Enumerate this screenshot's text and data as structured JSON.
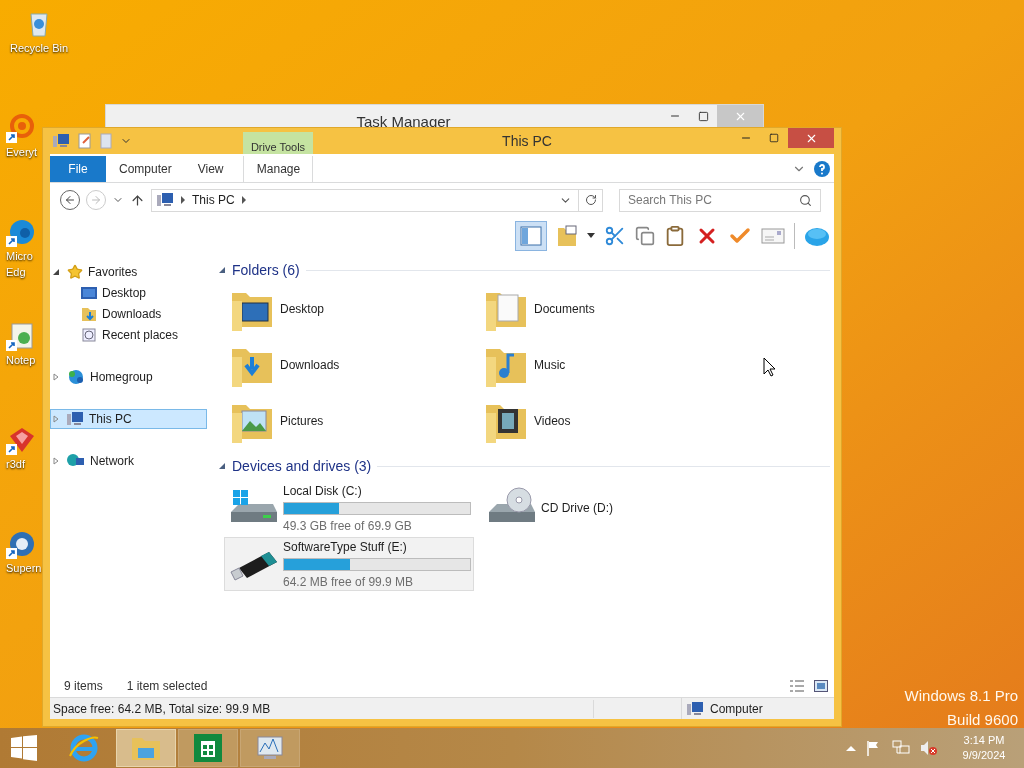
{
  "desktop": {
    "icons": [
      {
        "label": "Recycle Bin",
        "kind": "bin"
      },
      {
        "label": "Everyt",
        "kind": "ring"
      },
      {
        "label": "Micro Edg",
        "kind": "edge"
      },
      {
        "label": "Notep",
        "kind": "notepad"
      },
      {
        "label": "r3df",
        "kind": "r3d"
      },
      {
        "label": "Supern",
        "kind": "globe"
      }
    ],
    "edition": "Windows 8.1 Pro",
    "build": "Build 9600"
  },
  "background_window": {
    "title": "Task Manager"
  },
  "explorer": {
    "title": "This PC",
    "contextual_tab": "Drive Tools",
    "ribbon_tabs": [
      {
        "label": "File",
        "kind": "file"
      },
      {
        "label": "Computer",
        "kind": "tab"
      },
      {
        "label": "View",
        "kind": "tab"
      },
      {
        "label": "Manage",
        "kind": "contextual"
      }
    ],
    "address": {
      "path": [
        "This PC"
      ]
    },
    "search": {
      "placeholder": "Search This PC"
    },
    "nav": [
      {
        "label": "Favorites",
        "kind": "favorites",
        "expanded": true,
        "selected": false,
        "children": [
          {
            "label": "Desktop",
            "kind": "desktop",
            "selected": false
          },
          {
            "label": "Downloads",
            "kind": "downloads",
            "selected": false
          },
          {
            "label": "Recent places",
            "kind": "recent",
            "selected": false
          }
        ]
      },
      {
        "label": "Homegroup",
        "kind": "homegroup",
        "expanded": false,
        "selected": false
      },
      {
        "label": "This PC",
        "kind": "pc",
        "expanded": false,
        "selected": true
      },
      {
        "label": "Network",
        "kind": "network",
        "expanded": false,
        "selected": false
      }
    ],
    "folders": {
      "header": "Folders (6)",
      "items": [
        {
          "name": "Desktop",
          "kind": "desktop"
        },
        {
          "name": "Documents",
          "kind": "documents"
        },
        {
          "name": "Downloads",
          "kind": "downloads"
        },
        {
          "name": "Music",
          "kind": "music"
        },
        {
          "name": "Pictures",
          "kind": "pictures"
        },
        {
          "name": "Videos",
          "kind": "videos"
        }
      ]
    },
    "drives": {
      "header": "Devices and drives (3)",
      "items": [
        {
          "name": "Local Disk (C:)",
          "kind": "disk",
          "level": 0.295,
          "free": "49.3 GB free of 69.9 GB",
          "selected": false
        },
        {
          "name": "CD Drive (D:)",
          "kind": "cd",
          "selected": false
        },
        {
          "name": "SoftwareType Stuff (E:)",
          "kind": "usb",
          "level": 0.357,
          "free": "64.2 MB free of 99.9 MB",
          "selected": true
        }
      ]
    },
    "status": {
      "count": "9 items",
      "selection": "1 item selected"
    },
    "details": {
      "space": "Space free: 64.2 MB, Total size: 99.9 MB",
      "location": "Computer"
    }
  },
  "taskbar": {
    "apps": [
      {
        "kind": "ie",
        "active": false
      },
      {
        "kind": "explorer",
        "active": true
      },
      {
        "kind": "store",
        "active": false
      },
      {
        "kind": "taskmgr",
        "active": false
      }
    ],
    "tray": {
      "muted": true
    },
    "time": "3:14 PM",
    "date": "9/9/2024"
  }
}
